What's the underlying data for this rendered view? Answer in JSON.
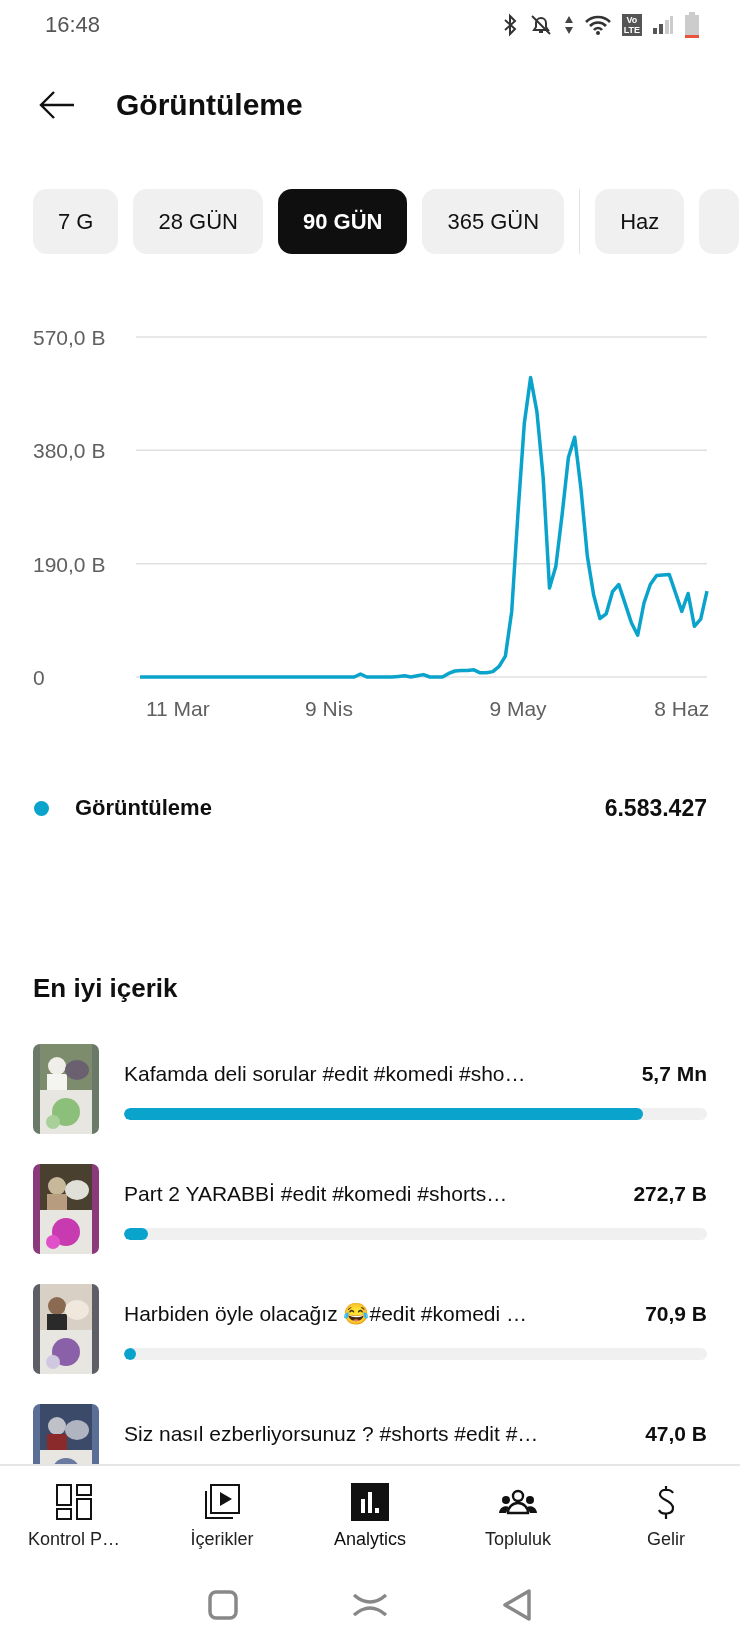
{
  "status_bar": {
    "time": "16:48",
    "volte_badge": [
      "Vo",
      "LTE"
    ]
  },
  "header": {
    "title": "Görüntüleme"
  },
  "period_chips": [
    {
      "label": "7 G",
      "selected": false
    },
    {
      "label": "28 GÜN",
      "selected": false
    },
    {
      "label": "90 GÜN",
      "selected": true
    },
    {
      "label": "365 GÜN",
      "selected": false
    },
    {
      "label": "Haz",
      "selected": false
    }
  ],
  "chart": {
    "chart_data": {
      "type": "line",
      "ylim": [
        0,
        570
      ],
      "yticks": [
        {
          "value": 0,
          "label": "0"
        },
        {
          "value": 190,
          "label": "190,0 B"
        },
        {
          "value": 380,
          "label": "380,0 B"
        },
        {
          "value": 570,
          "label": "570,0 B"
        }
      ],
      "categories": [
        null,
        null,
        null,
        null,
        null,
        null,
        "11 Mar",
        null,
        null,
        null,
        null,
        null,
        null,
        null,
        null,
        null,
        null,
        null,
        null,
        null,
        null,
        null,
        null,
        null,
        null,
        null,
        null,
        null,
        null,
        null,
        "9 Nis",
        null,
        null,
        null,
        null,
        null,
        null,
        null,
        null,
        null,
        null,
        null,
        null,
        null,
        null,
        null,
        null,
        null,
        null,
        null,
        null,
        null,
        null,
        null,
        null,
        null,
        null,
        null,
        null,
        null,
        "9 May",
        null,
        null,
        null,
        null,
        null,
        null,
        null,
        null,
        null,
        null,
        null,
        null,
        null,
        null,
        null,
        null,
        null,
        null,
        null,
        null,
        null,
        null,
        null,
        null,
        null,
        "8 Haz",
        null,
        null,
        null,
        null
      ],
      "series": [
        {
          "name": "Görüntüleme",
          "color": "#0aa3cc",
          "values": [
            0,
            0,
            0,
            0,
            0,
            0,
            0,
            0,
            0,
            0,
            0,
            0,
            0,
            0,
            0,
            0,
            0,
            0,
            0,
            0,
            0,
            0,
            0,
            0,
            0,
            0,
            0,
            0,
            0,
            0,
            0,
            0,
            0,
            0,
            0,
            5,
            0,
            0,
            0,
            0,
            0,
            1,
            2,
            0,
            2,
            4,
            0,
            0,
            0,
            6,
            10,
            11,
            11,
            12,
            7,
            7,
            9,
            18,
            35,
            110,
            275,
            425,
            502,
            445,
            334,
            149,
            185,
            272,
            368,
            402,
            315,
            203,
            138,
            98,
            106,
            143,
            155,
            123,
            91,
            70,
            124,
            155,
            170,
            171,
            172,
            141,
            110,
            140,
            85,
            97,
            144
          ]
        }
      ]
    }
  },
  "legend": {
    "color": "#0aa3cc",
    "total": "6.583.427"
  },
  "top_content": {
    "title": "En iyi içerik",
    "items": [
      {
        "title": "Kafamda deli sorular #edit #komedi #sho…",
        "value": "5,7 Mn",
        "level": 0.89
      },
      {
        "title": "Part 2 YARABBİ  #edit #komedi #shorts…",
        "value": "272,7 B",
        "level": 0.042
      },
      {
        "title": "Harbiden öyle olacağız 😂#edit #komedi …",
        "value": "70,9 B",
        "level": 0.012
      },
      {
        "title": "Siz nasıl ezberliyorsunuz ? #shorts #edit #…",
        "value": "47,0 B"
      }
    ]
  },
  "bottom_nav": [
    {
      "label": "Kontrol P…",
      "kind": "dashboard",
      "selected": false
    },
    {
      "label": "İçerikler",
      "kind": "content",
      "selected": false
    },
    {
      "label": "Analytics",
      "kind": "analytics",
      "selected": true
    },
    {
      "label": "Topluluk",
      "kind": "community",
      "selected": false
    },
    {
      "label": "Gelir",
      "kind": "earn",
      "selected": false
    }
  ]
}
